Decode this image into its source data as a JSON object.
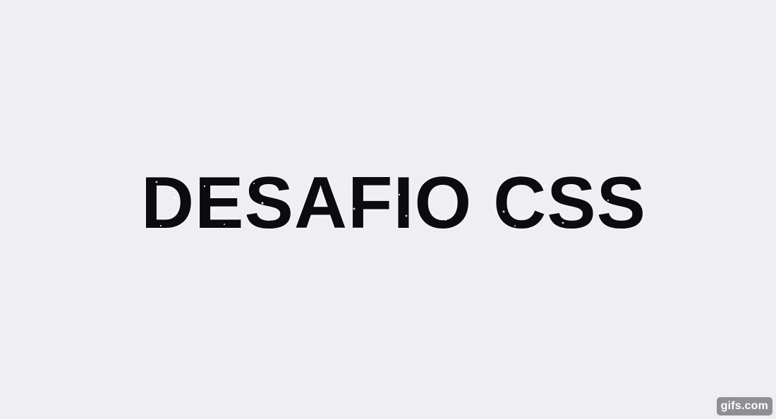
{
  "headline": {
    "text": "DESAFIO CSS",
    "color": "#0c0c0e"
  },
  "background": {
    "color": "#efeff3"
  },
  "watermark": {
    "text": "gifs.com",
    "color": "#8f8f93"
  }
}
